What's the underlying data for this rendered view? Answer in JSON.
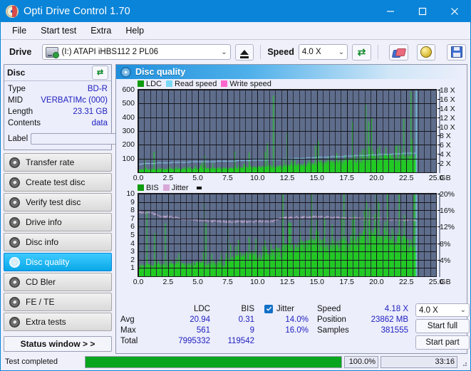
{
  "window": {
    "title": "Opti Drive Control 1.70",
    "app_icon": "disc-icon",
    "minimize": "minimize-icon",
    "maximize": "maximize-icon",
    "close": "close-icon",
    "titlebar_color": "#0a84d8"
  },
  "menu": [
    {
      "label": "File"
    },
    {
      "label": "Start test"
    },
    {
      "label": "Extra"
    },
    {
      "label": "Help"
    }
  ],
  "toolbar": {
    "drive_label": "Drive",
    "drive_value": "(I:)   ATAPI iHBS112   2 PL06",
    "drive_icon": "drive-icon",
    "eject_icon": "eject-icon",
    "speed_label": "Speed",
    "speed_value": "4.0 X",
    "refresh_icon": "refresh-icon",
    "eraser_icon": "eraser-icon",
    "bulb_icon": "bulb-icon",
    "save_icon": "save-icon"
  },
  "disc_panel": {
    "title": "Disc",
    "refresh_icon": "refresh-icon",
    "rows": [
      {
        "key": "Type",
        "value": "BD-R"
      },
      {
        "key": "MID",
        "value": "VERBATIMc (000)"
      },
      {
        "key": "Length",
        "value": "23.31 GB"
      },
      {
        "key": "Contents",
        "value": "data"
      }
    ],
    "label_key": "Label",
    "label_value": "",
    "label_placeholder": "",
    "cd_icon": "cd-icon"
  },
  "nav": {
    "items": [
      {
        "label": "Transfer rate",
        "icon": "disc-icon",
        "active": false
      },
      {
        "label": "Create test disc",
        "icon": "disc-icon",
        "active": false
      },
      {
        "label": "Verify test disc",
        "icon": "disc-icon",
        "active": false
      },
      {
        "label": "Drive info",
        "icon": "disc-icon",
        "active": false
      },
      {
        "label": "Disc info",
        "icon": "disc-icon",
        "active": false
      },
      {
        "label": "Disc quality",
        "icon": "disc-icon",
        "active": true
      },
      {
        "label": "CD Bler",
        "icon": "disc-icon",
        "active": false
      },
      {
        "label": "FE / TE",
        "icon": "disc-icon",
        "active": false
      },
      {
        "label": "Extra tests",
        "icon": "disc-icon",
        "active": false
      }
    ],
    "status_window": "Status window > >"
  },
  "panel": {
    "title": "Disc quality",
    "icon": "disc-icon"
  },
  "stats": {
    "col_headers": [
      "LDC",
      "BIS"
    ],
    "rows": [
      {
        "label": "Avg",
        "ldc": "20.94",
        "bis": "0.31",
        "jitter": "14.0%"
      },
      {
        "label": "Max",
        "ldc": "561",
        "bis": "9",
        "jitter": "16.0%"
      },
      {
        "label": "Total",
        "ldc": "7995332",
        "bis": "119542",
        "jitter": ""
      }
    ],
    "jitter_label": "Jitter",
    "jitter_checked": true,
    "jitter_avg": "14.0%",
    "jitter_max": "16.0%",
    "speed_key": "Speed",
    "speed_value": "4.18 X",
    "position_key": "Position",
    "position_value": "23862 MB",
    "samples_key": "Samples",
    "samples_value": "381555",
    "speed_select": "4.0 X",
    "start_full": "Start full",
    "start_part": "Start part"
  },
  "statusbar": {
    "message": "Test completed",
    "percent_text": "100.0%",
    "percent_value": 100,
    "time": "33:16",
    "progress_color": "#0aa51e"
  },
  "chart_data": [
    {
      "type": "area",
      "name": "ldc-chart",
      "title": "",
      "xlabel": "GB",
      "ylabel": "",
      "xlim": [
        0,
        25
      ],
      "ylim": [
        0,
        600
      ],
      "y2lim": [
        0,
        18
      ],
      "xticks": [
        "0.0",
        "2.5",
        "5.0",
        "7.5",
        "10.0",
        "12.5",
        "15.0",
        "17.5",
        "20.0",
        "22.5",
        "25.0"
      ],
      "yticks": [
        100,
        200,
        300,
        400,
        500,
        600
      ],
      "y2ticks": [
        "2 X",
        "4 X",
        "6 X",
        "8 X",
        "10 X",
        "12 X",
        "14 X",
        "16 X",
        "18 X"
      ],
      "grid": true,
      "legend": [
        {
          "label": "LDC",
          "color": "#0f9b0f"
        },
        {
          "label": "Read speed",
          "color": "#79d8f5"
        },
        {
          "label": "Write speed",
          "color": "#ff66cc"
        }
      ],
      "series": [
        {
          "name": "LDC",
          "color": "#22cc22",
          "kind": "bars",
          "note": "Error count per sample, dense green spikes; baseline rises from ~20 at 0GB to ~120 at 23.3GB; isolated spike to 561 at ~11.3GB, cluster of spikes 180-490 between 18.5-22.5GB; data ends at 23.31GB",
          "baseline": [
            20,
            22,
            24,
            25,
            27,
            28,
            30,
            32,
            34,
            36,
            40,
            44,
            48,
            55,
            62,
            70,
            78,
            86,
            95,
            105,
            112,
            118,
            120,
            120
          ],
          "max_value": 561,
          "avg_value": 20.94,
          "end_gb": 23.31
        },
        {
          "name": "Read speed",
          "color": "#8fe0ff",
          "kind": "line",
          "note": "Stepped CAV read speed curve rising from about 1.9X at 0GB to 4.3X at 23.3GB",
          "x": [
            0,
            1,
            2,
            3,
            4,
            5,
            6,
            7,
            8,
            9,
            10,
            11,
            12,
            13,
            14,
            15,
            16,
            17,
            18,
            19,
            20,
            21,
            22,
            23.3
          ],
          "y": [
            1.9,
            2.0,
            2.15,
            2.2,
            2.3,
            2.35,
            2.4,
            2.5,
            2.55,
            2.65,
            2.75,
            2.85,
            2.95,
            3.1,
            3.2,
            3.35,
            3.45,
            3.55,
            3.7,
            3.8,
            3.95,
            4.05,
            4.2,
            4.3
          ]
        }
      ]
    },
    {
      "type": "area",
      "name": "bis-chart",
      "title": "",
      "xlabel": "GB",
      "ylabel": "",
      "xlim": [
        0,
        25
      ],
      "ylim": [
        0,
        10
      ],
      "y2lim": [
        0,
        20
      ],
      "xticks": [
        "0.0",
        "2.5",
        "5.0",
        "7.5",
        "10.0",
        "12.5",
        "15.0",
        "17.5",
        "20.0",
        "22.5",
        "25.0"
      ],
      "yticks": [
        1,
        2,
        3,
        4,
        5,
        6,
        7,
        8,
        9,
        10
      ],
      "y2ticks": [
        "4%",
        "8%",
        "12%",
        "16%",
        "20%"
      ],
      "grid": true,
      "legend": [
        {
          "label": "BIS",
          "color": "#0f9b0f"
        },
        {
          "label": "Jitter",
          "color": "#d9a8d9"
        }
      ],
      "series": [
        {
          "name": "BIS",
          "color": "#22cc22",
          "kind": "bars",
          "note": "BIS error bars: mostly 1-2 up to 7.5GB, rising to 3-4 by 12.5GB, 4-6 from 17-23GB with spikes to 8-9; ends at 23.31GB",
          "baseline": [
            1.3,
            1.4,
            1.5,
            1.5,
            1.5,
            1.6,
            1.6,
            1.7,
            2.4,
            2.6,
            2.7,
            2.9,
            3.6,
            3.8,
            3.9,
            4.0,
            4.0,
            4.2,
            4.6,
            5.0,
            4.9,
            4.6,
            4.2,
            4.0
          ],
          "max_value": 9,
          "avg_value": 0.31,
          "end_gb": 23.31
        },
        {
          "name": "Jitter",
          "color": "#e3b9e3",
          "kind": "line",
          "note": "Jitter noisy line near 13-16%, starting about 15.6% falling to ~13.2% around 5-11GB then ~14.2% to the end",
          "x": [
            0,
            1,
            2,
            3,
            4,
            5,
            6,
            7,
            8,
            9,
            10,
            11,
            12,
            13,
            14,
            15,
            16,
            17,
            18,
            19,
            20,
            21,
            22,
            23.3
          ],
          "y": [
            15.6,
            15.5,
            14.6,
            14.3,
            13.8,
            13.6,
            13.4,
            13.3,
            13.3,
            13.3,
            13.4,
            13.3,
            14.2,
            14.3,
            14.4,
            14.5,
            14.3,
            14.2,
            14.1,
            14.0,
            14.0,
            13.9,
            13.8,
            13.8
          ]
        }
      ]
    }
  ]
}
